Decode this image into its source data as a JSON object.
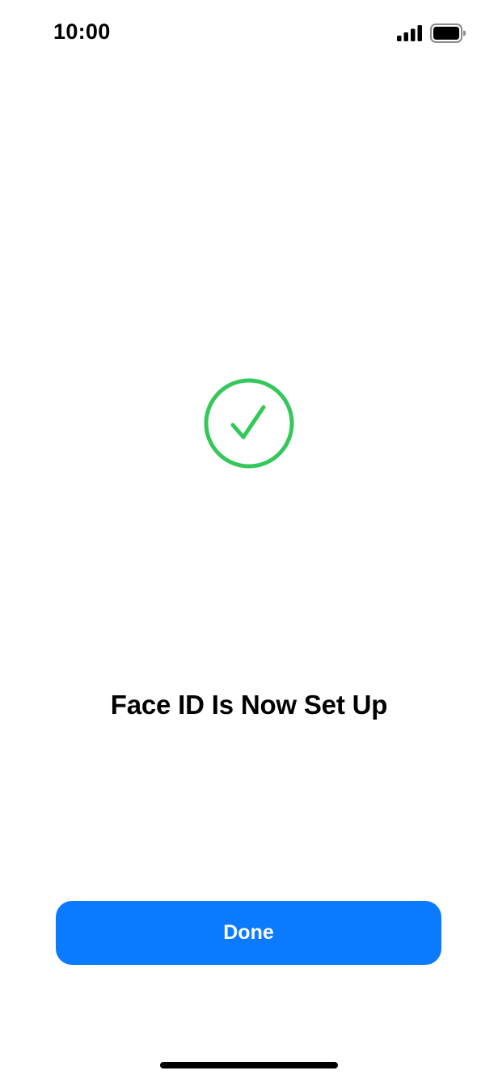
{
  "status_bar": {
    "time": "10:00",
    "icons": [
      "signal-icon",
      "battery-icon"
    ]
  },
  "main": {
    "icon": "checkmark-circle-icon",
    "title": "Face ID Is Now Set Up"
  },
  "actions": {
    "done_label": "Done"
  },
  "colors": {
    "accent": "#0a7aff",
    "success": "#34c759",
    "background": "#ffffff",
    "text": "#000000"
  }
}
